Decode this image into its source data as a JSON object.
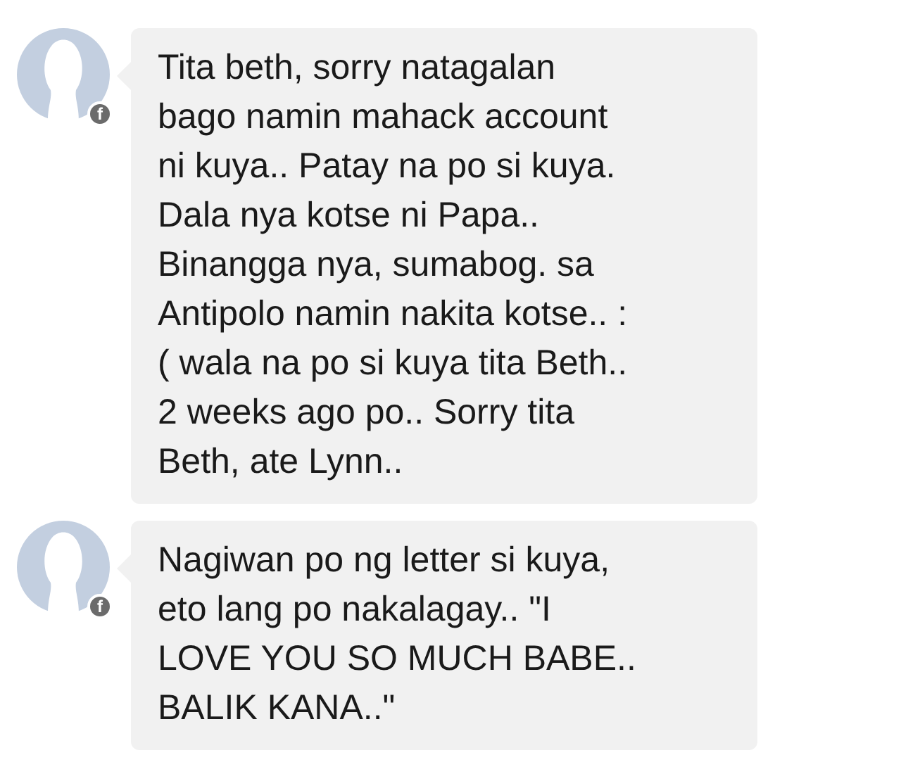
{
  "messages": [
    {
      "badge": "f",
      "text": "Tita beth, sorry natagalan\nbago namin mahack account\nni kuya.. Patay na po si kuya.\nDala nya kotse ni Papa..\nBinangga nya, sumabog. sa\nAntipolo namin nakita kotse.. :\n( wala na po si kuya tita Beth..\n2 weeks ago po.. Sorry tita\nBeth, ate Lynn.."
    },
    {
      "badge": "f",
      "text": "Nagiwan po ng letter si kuya,\neto lang po nakalagay.. \"I\nLOVE YOU SO MUCH BABE..\nBALIK KANA..\""
    }
  ]
}
